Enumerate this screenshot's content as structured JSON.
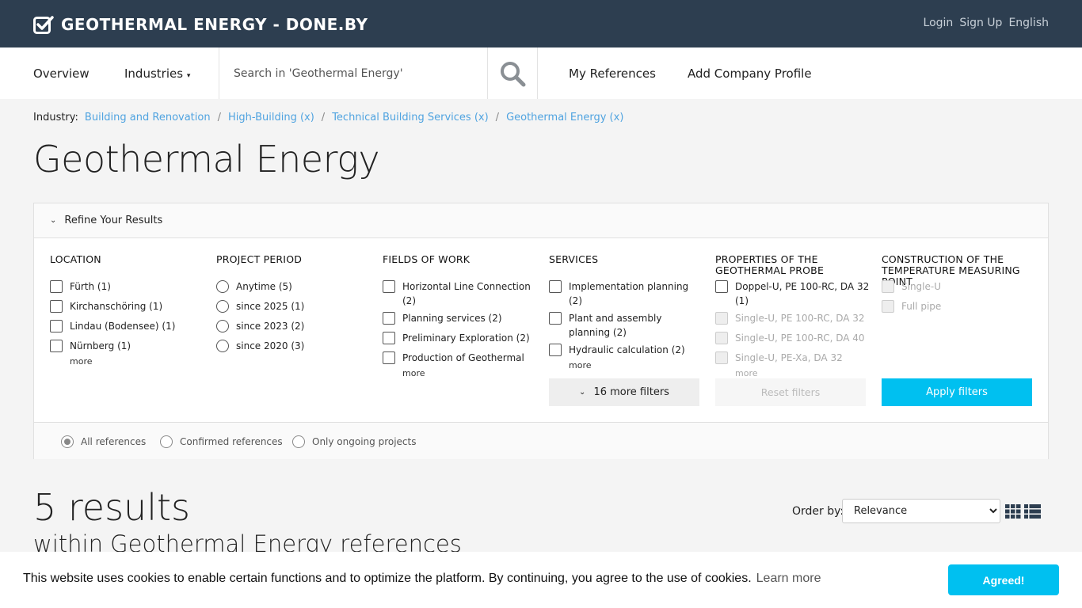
{
  "brand": {
    "name": "GEOTHERMAL ENERGY - DONE.BY"
  },
  "top_links": {
    "login": "Login",
    "signup": "Sign Up",
    "language": "English"
  },
  "nav": {
    "overview": "Overview",
    "industries": "Industries",
    "search_placeholder": "Search in 'Geothermal Energy'",
    "my_references": "My References",
    "add_company": "Add Company Profile"
  },
  "breadcrumb": {
    "label": "Industry:",
    "items": [
      "Building and Renovation",
      "High-Building (x)",
      "Technical Building Services (x)",
      "Geothermal Energy (x)"
    ]
  },
  "page_title": "Geothermal Energy",
  "filters": {
    "heading": "Refine Your Results",
    "location": {
      "title": "LOCATION",
      "options": [
        "Fürth (1)",
        "Kirchanschöring (1)",
        "Lindau (Bodensee) (1)",
        "Nürnberg (1)"
      ],
      "more": "more"
    },
    "period": {
      "title": "PROJECT PERIOD",
      "options": [
        "Anytime (5)",
        "since 2025 (1)",
        "since 2023 (2)",
        "since 2020 (3)"
      ]
    },
    "fields": {
      "title": "FIELDS OF WORK",
      "options": [
        "Horizontal Line Connection (2)",
        "Planning services (2)",
        "Preliminary Exploration (2)",
        "Production of Geothermal"
      ],
      "more": "more"
    },
    "services": {
      "title": "SERVICES",
      "options": [
        "Implementation planning (2)",
        "Plant and assembly planning (2)",
        "Hydraulic calculation (2)"
      ],
      "more": "more"
    },
    "probe": {
      "title": "PROPERTIES OF THE GEOTHERMAL PROBE",
      "options": [
        "Doppel-U, PE 100-RC, DA 32 (1)",
        "Single-U, PE 100-RC, DA 32",
        "Single-U, PE 100-RC, DA 40",
        "Single-U, PE-Xa, DA 32"
      ],
      "more": "more"
    },
    "temp": {
      "title": "CONSTRUCTION OF THE TEMPERATURE MEASURING POINT",
      "options": [
        "Single-U",
        "Full pipe"
      ]
    },
    "more_filters": "16 more filters",
    "reset": "Reset filters",
    "apply": "Apply filters",
    "scope": [
      "All references",
      "Confirmed references",
      "Only ongoing projects"
    ]
  },
  "results": {
    "count": "5 results",
    "subtitle": "within Geothermal Energy references",
    "order_label": "Order by:",
    "order_value": "Relevance"
  },
  "cookie": {
    "message": "This website uses cookies to enable certain functions and to optimize the platform. By continuing, you agree to the use of cookies.",
    "learn_more": "Learn more",
    "button": "Agreed!"
  },
  "colors": {
    "header_bg": "#2d3e50",
    "accent": "#00c0f0",
    "link": "#4fa3e0"
  }
}
